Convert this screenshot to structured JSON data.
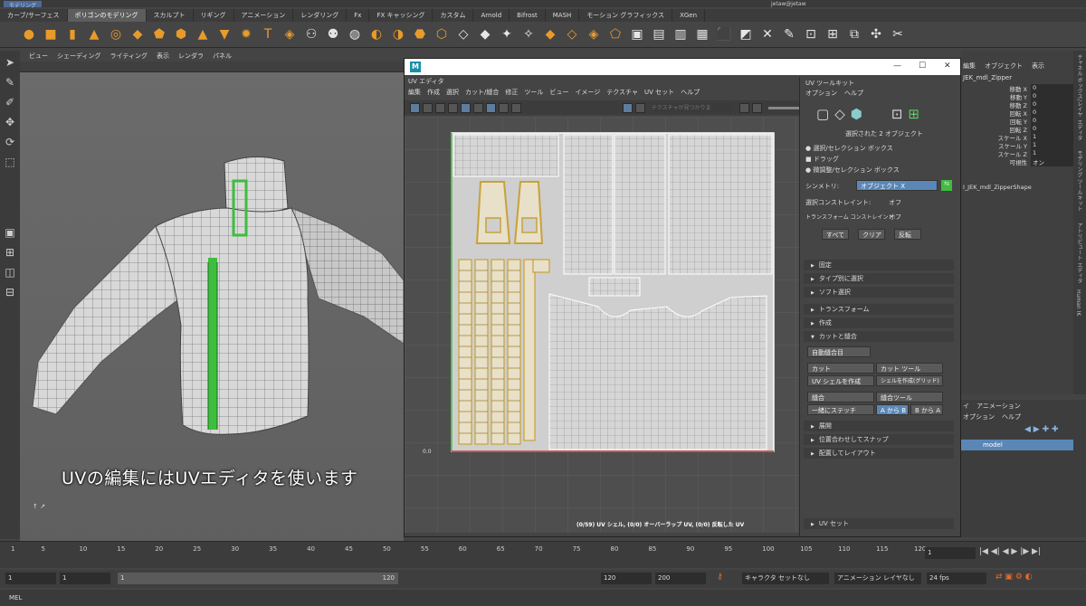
{
  "menubar": {
    "menu_set": "モデリング",
    "user": "jetaw@jetaw"
  },
  "shelf_tabs": [
    "カーブ/サーフェス",
    "ポリゴンのモデリング",
    "スカルプト",
    "リギング",
    "アニメーション",
    "レンダリング",
    "Fx",
    "FX キャッシング",
    "カスタム",
    "Arnold",
    "Bifrost",
    "MASH",
    "モーション グラフィックス",
    "XGen"
  ],
  "viewport": {
    "menu": [
      "ビュー",
      "シェーディング",
      "ライティング",
      "表示",
      "レンダラ",
      "パネル"
    ]
  },
  "subtitle": "UVの編集にはUVエディタを使います",
  "uv_editor": {
    "title": "UV エディタ",
    "menu": [
      "編集",
      "作成",
      "選択",
      "カット/縫合",
      "修正",
      "ツール",
      "ビュー",
      "イメージ",
      "テクスチャ",
      "UV セット",
      "ヘルプ"
    ],
    "texture_placeholder": "テクスチャが見つかりま",
    "status": "(0/59) UV シェル, (0/0) オーバーラップ UV, (0/0) 反転した UV",
    "axis_labels": [
      "0,1",
      "0,1",
      "0.0"
    ]
  },
  "uv_toolkit": {
    "title": "UV ツールキット",
    "menu": [
      "オプション",
      "ヘルプ"
    ],
    "selected": "選択された 2 オブジェクト",
    "modes": [
      "選択/セレクション ボックス",
      "ドラッグ",
      "微調整/セレクション ボックス"
    ],
    "symmetry_label": "シンメトリ:",
    "symmetry_value": "オブジェクト X",
    "sel_constraint_label": "選択コンストレイント:",
    "sel_constraint_value": "オフ",
    "transform_constraint_label": "トランスフォーム コンストレイント:",
    "transform_constraint_value": "オフ",
    "buttons": [
      "すべて",
      "クリア",
      "反転"
    ],
    "sections_top": [
      "固定",
      "タイプ別に選択",
      "ソフト選択"
    ],
    "sections_mid": [
      "トランスフォーム",
      "作成",
      "カットと縫合"
    ],
    "cut_sew": {
      "auto_seam": "自動縫合目",
      "cut": "カット",
      "cut_tool": "カット ツール",
      "create_uv_shell": "UV シェルを作成",
      "create_shell_grid": "シェルを作成(グリッド)",
      "sew": "縫合",
      "sew_tool": "縫合ツール",
      "stitch": "一緒にステッチ",
      "a_to_b": "A から B",
      "b_to_a": "B から A"
    },
    "sections_bottom": [
      "展開",
      "位置合わせしてスナップ",
      "配置してレイアウト"
    ],
    "uv_set": "UV セット"
  },
  "channel_box": {
    "menu": [
      "編集",
      "オブジェクト",
      "表示"
    ],
    "object": "JEK_mdl_Zipper",
    "attrs": [
      [
        "移動 X",
        "0"
      ],
      [
        "移動 Y",
        "0"
      ],
      [
        "移動 Z",
        "0"
      ],
      [
        "回転 X",
        "0"
      ],
      [
        "回転 Y",
        "0"
      ],
      [
        "回転 Z",
        "0"
      ],
      [
        "スケール X",
        "1"
      ],
      [
        "スケール Y",
        "1"
      ],
      [
        "スケール Z",
        "1"
      ],
      [
        "可視性",
        "オン"
      ]
    ],
    "shape": "I_JEK_mdl_ZipperShape"
  },
  "side_tabs": [
    "チャネル ボックス/レイヤ エディタ",
    "モデリング ツールキット",
    "アトリビュート エディタ",
    "Human IK"
  ],
  "layer_editor": {
    "tabs": [
      "イ",
      "アニメーション"
    ],
    "menu": [
      "オプション",
      "ヘルプ"
    ],
    "layer": "model"
  },
  "timeline": {
    "ticks": [
      "1",
      "5",
      "10",
      "15",
      "20",
      "25",
      "30",
      "35",
      "40",
      "45",
      "50",
      "55",
      "60",
      "65",
      "70",
      "75",
      "80",
      "85",
      "90",
      "95",
      "100",
      "105",
      "110",
      "115",
      "120"
    ],
    "current": "1"
  },
  "range": {
    "start": "1",
    "start2": "1",
    "slider_start": "1",
    "slider_end": "120",
    "end": "120",
    "end2": "200",
    "character_set": "キャラクタ セットなし",
    "anim_layer": "アニメーション レイヤなし",
    "fps": "24 fps"
  },
  "mel": "MEL"
}
